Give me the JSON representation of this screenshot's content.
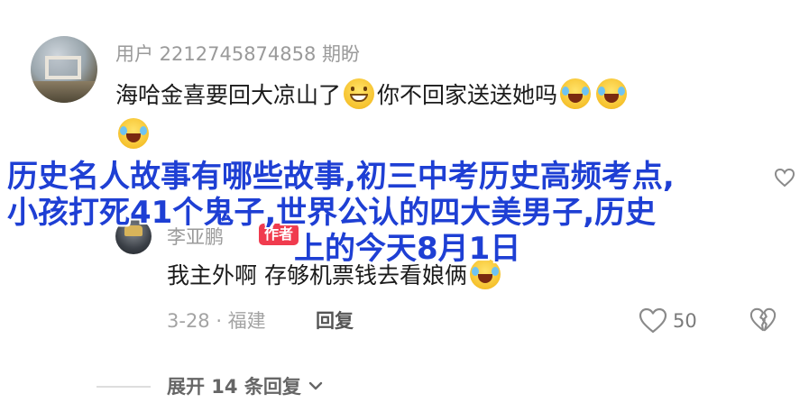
{
  "comment": {
    "username": "用户 2212745874858 期盼",
    "text_part1": "海哈金喜要回大凉山了",
    "text_part2": "你不回家送送她吗",
    "emojis": [
      "grinning-face-icon",
      "crying-laughing-icon"
    ]
  },
  "reply": {
    "username": "李亚鹏",
    "badge": "作者",
    "text": "我主外啊 存够机票钱去看娘俩",
    "meta": "3-28 · 福建",
    "reply_label": "回复",
    "like_count": "50"
  },
  "expand": {
    "label": "展开 14 条回复",
    "chevron": "chevron-down-icon"
  },
  "overlay": {
    "line1": "历史名人故事有哪些故事,初三中考历史高频考点,",
    "line2": "小孩打死41个鬼子,世界公认的四大美男子,历史",
    "line3": "上的今天8月1日"
  },
  "colors": {
    "overlay_text": "#1e3fd4",
    "author_badge": "#f03b4e",
    "muted_text": "#9a9a9a"
  }
}
